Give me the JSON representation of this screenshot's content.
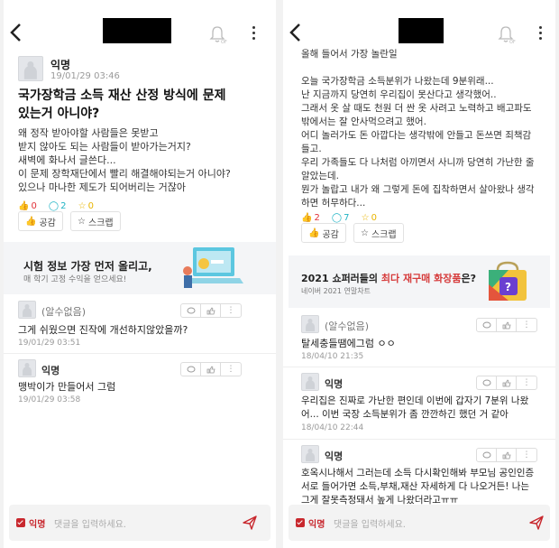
{
  "left": {
    "author": "익명",
    "date": "19/01/29 03:46",
    "title_lines": [
      "국가장학금 소득 재산 산정 방식에 문제",
      "있는거 아니야?"
    ],
    "body_lines": [
      "왜 정작 받아야할 사람들은 못받고",
      "받지 않아도 되는 사람들이 받아가는거지?",
      "새벽에 화나서 글쓴다...",
      "이 문제 장학재단에서 빨리 해결해야되는거 아니야?",
      "있으나 마나한 제도가 되어버리는 거잖아"
    ],
    "stats": {
      "likes": "0",
      "comments": "2",
      "scraps": "0"
    },
    "like_label": "공감",
    "scrap_label": "스크랩",
    "banner": {
      "title": "시험 정보 가장 먼저 올리고,",
      "subtitle": "매 학기 고정 수익을 얻으세요!"
    },
    "comments": [
      {
        "name": "(알수없음)",
        "text": "그게 쉬웠으면 진작에 개선하지않았을까?",
        "date": "19/01/29 03:51"
      },
      {
        "name": "익명",
        "text": "맹박이가 만들어서 그럼",
        "date": "19/01/29 03:58"
      }
    ],
    "input": {
      "anon_label": "익명",
      "placeholder": "댓글을 입력하세요."
    }
  },
  "right": {
    "body_lines": [
      "올해 들어서 가장 놀란일",
      "",
      "오늘 국가장학금 소득분위가 나왔는데 9분위래...",
      "난 지금까지 당연히 우리집이 못산다고 생각했어..",
      "그래서 옷 살 때도 천원 더 싼 옷 사려고 노력하고 배고파도",
      "밖에서는 잘 안사먹으려고 했어.",
      "어디 놀러가도 돈 아깝다는 생각밖에 안들고 돈쓰면 죄책감",
      "들고.",
      "우리 가족들도 다 나처럼 아끼면서 사니까 당연히 가난한 줄",
      "알았는데.",
      "뭔가 놀랍고 내가 왜 그렇게 돈에 집착하면서 살아왔나 생각",
      "하면 허무하다..."
    ],
    "stats": {
      "likes": "2",
      "comments": "7",
      "scraps": "0"
    },
    "like_label": "공감",
    "scrap_label": "스크랩",
    "banner": {
      "title_pre": "2021 쇼퍼러들의 ",
      "title_hl": "최다 재구매 화장품",
      "title_post": "은?",
      "subtitle": "네이버 2021 연말차트"
    },
    "comments": [
      {
        "name": "(알수없음)",
        "lines": [
          "탈세충들땜에그럼 ㅇㅇ"
        ],
        "date": "18/04/10 21:35"
      },
      {
        "name": "익명",
        "lines": [
          "우리집은 진짜로 가난한 편인데 이번에 갑자기 7분위 나왔",
          "어... 이번 국장 소득분위가 좀 깐깐하긴 했던 거 같아"
        ],
        "date": "18/04/10 22:44"
      },
      {
        "name": "익명",
        "lines": [
          "호옥시나해서 그러는데 소득 다시확인해봐 부모님 공인인증",
          "서로 들어가면 소득,부채,재산 자세하게 다 나오거든! 나는",
          "그게 잘못측정돼서 높게 나왔더라고ㅠㅠ"
        ],
        "date": ""
      }
    ],
    "input": {
      "anon_label": "익명",
      "placeholder": "댓글을 입력하세요."
    }
  },
  "colors": {
    "like": "#e0323a",
    "comment": "#1fb3c4",
    "scrap": "#e8b400",
    "brand": "#c8282e",
    "highlight": "#d63b3b"
  }
}
